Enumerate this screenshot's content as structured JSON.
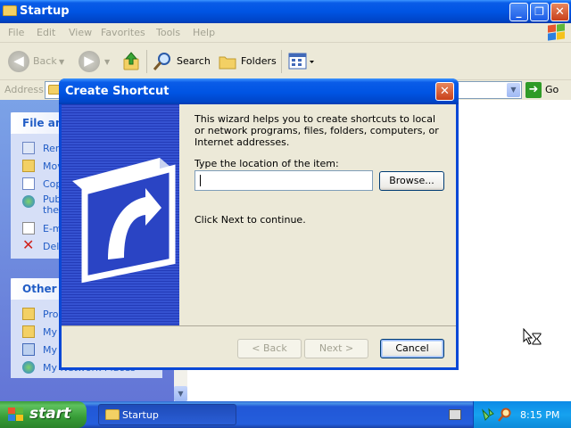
{
  "window": {
    "title": "Startup",
    "controls": {
      "minimize": "_",
      "maximize": "❐",
      "close": "✕"
    }
  },
  "menubar": {
    "items": [
      "File",
      "Edit",
      "View",
      "Favorites",
      "Tools",
      "Help"
    ]
  },
  "toolbar": {
    "back_label": "Back",
    "search_label": "Search",
    "folders_label": "Folders"
  },
  "addressbar": {
    "label": "Address",
    "go_label": "Go",
    "value": ""
  },
  "leftpane": {
    "file_tasks_header": "File and Folder Tasks",
    "file_tasks": [
      {
        "label": "Rename this file",
        "icon": "rename-icon"
      },
      {
        "label": "Move this file",
        "icon": "move-icon"
      },
      {
        "label": "Copy this file",
        "icon": "copy-icon"
      },
      {
        "label": "Publish this file to the Web",
        "icon": "publish-icon"
      },
      {
        "label": "E-mail this file",
        "icon": "email-icon"
      },
      {
        "label": "Delete this file",
        "icon": "delete-icon"
      }
    ],
    "other_places_header": "Other Places",
    "other_places": [
      {
        "label": "Programs",
        "icon": "programs-folder-icon"
      },
      {
        "label": "My Documents",
        "icon": "my-documents-icon"
      },
      {
        "label": "My Computer",
        "icon": "my-computer-icon"
      },
      {
        "label": "My Network Places",
        "icon": "network-places-icon"
      }
    ]
  },
  "dialog": {
    "title": "Create Shortcut",
    "description": "This wizard helps you to create shortcuts to local or network programs, files, folders, computers, or Internet addresses.",
    "location_label": "Type the location of the item:",
    "location_value": "",
    "browse_label": "Browse...",
    "continue_text": "Click Next to continue.",
    "back_label": "< Back",
    "next_label": "Next >",
    "cancel_label": "Cancel"
  },
  "taskbar": {
    "start_label": "start",
    "task_label": "Startup",
    "clock": "8:15 PM"
  },
  "colors": {
    "xp_blue": "#0054e3",
    "start_green": "#379c37",
    "pane_blue": "#6375d6",
    "dialog_face": "#ece9d8"
  }
}
